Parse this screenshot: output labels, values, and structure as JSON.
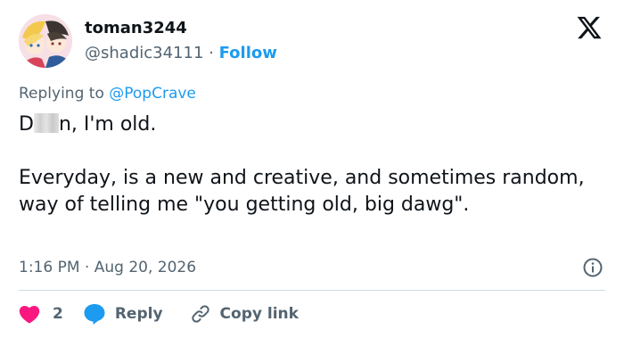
{
  "user": {
    "display_name": "toman3244",
    "handle": "@shadic34111",
    "separator": "·",
    "follow_label": "Follow"
  },
  "reply_context": {
    "prefix": "Replying to",
    "mention": "@PopCrave"
  },
  "tweet": {
    "line1_start": "D",
    "line1_end": "n, I'm old.",
    "paragraph2": "Everyday, is a new and creative, and sometimes random, way of telling me \"you getting old, big dawg\"."
  },
  "meta": {
    "time": "1:16 PM",
    "separator": "·",
    "date": "Aug 20, 2026"
  },
  "actions": {
    "like_count": "2",
    "reply_label": "Reply",
    "copy_label": "Copy link"
  },
  "colors": {
    "accent": "#1d9bf0",
    "secondary_text": "#536471",
    "like": "#f91880",
    "divider": "#cfd9de"
  },
  "icons": [
    "x-logo-icon",
    "info-icon",
    "heart-icon",
    "reply-bubble-icon",
    "link-icon"
  ]
}
